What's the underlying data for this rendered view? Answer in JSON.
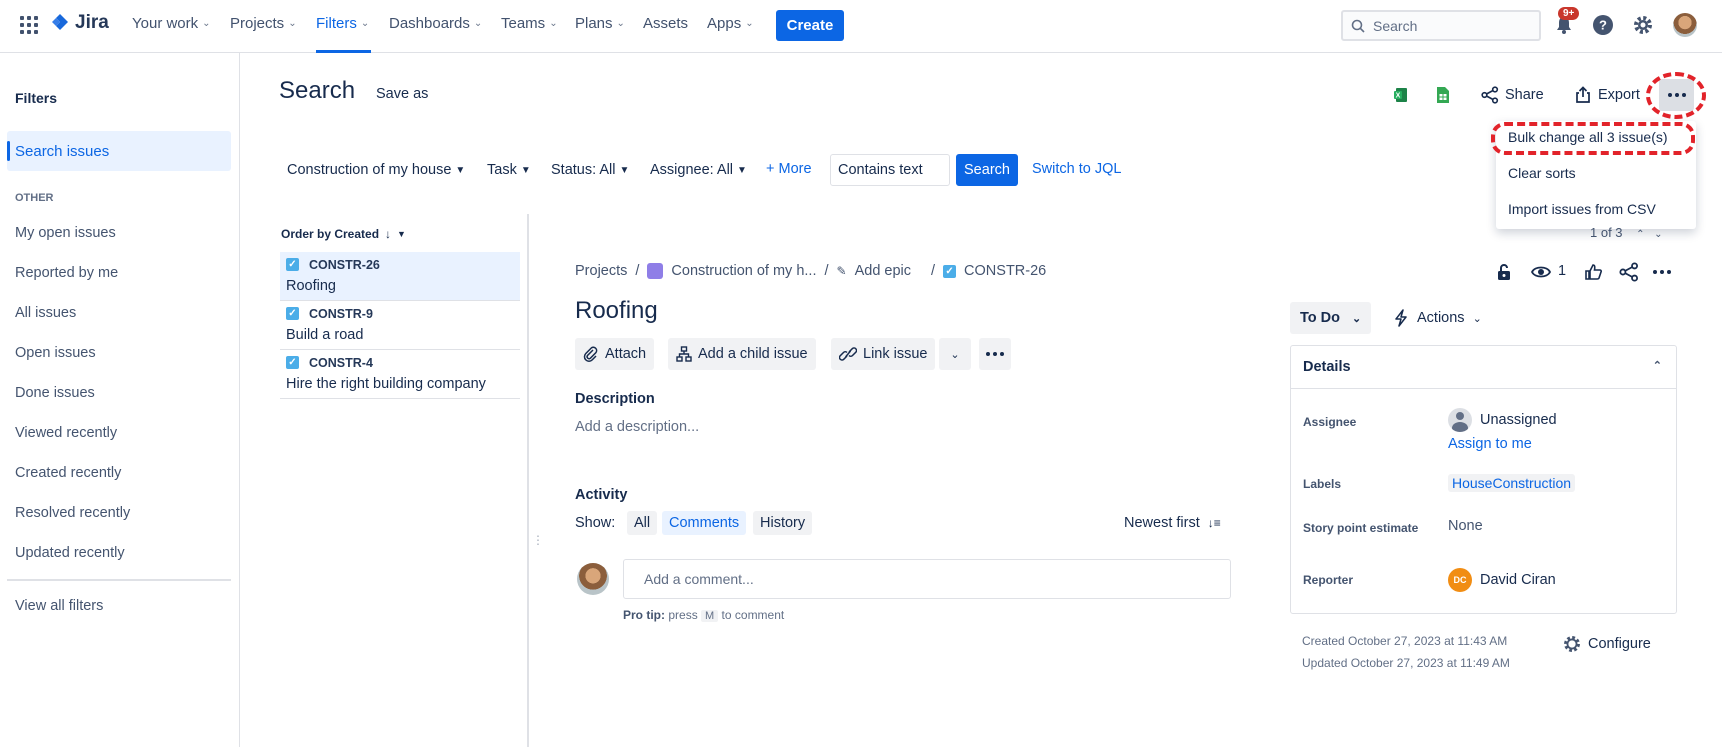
{
  "app": {
    "name": "Jira"
  },
  "topnav": {
    "items": [
      {
        "label": "Your work"
      },
      {
        "label": "Projects"
      },
      {
        "label": "Filters"
      },
      {
        "label": "Dashboards"
      },
      {
        "label": "Teams"
      },
      {
        "label": "Plans"
      },
      {
        "label": "Assets"
      },
      {
        "label": "Apps"
      }
    ],
    "create_label": "Create",
    "search_placeholder": "Search",
    "notifications_badge": "9+"
  },
  "sidebar": {
    "title": "Filters",
    "active_item": "Search issues",
    "section_label": "OTHER",
    "items": [
      {
        "label": "My open issues"
      },
      {
        "label": "Reported by me"
      },
      {
        "label": "All issues"
      },
      {
        "label": "Open issues"
      },
      {
        "label": "Done issues"
      },
      {
        "label": "Viewed recently"
      },
      {
        "label": "Created recently"
      },
      {
        "label": "Resolved recently"
      },
      {
        "label": "Updated recently"
      }
    ],
    "view_all": "View all filters"
  },
  "header": {
    "title": "Search",
    "save_as": "Save as",
    "share": "Share",
    "export": "Export"
  },
  "more_menu": {
    "items": [
      {
        "label": "Bulk change all 3 issue(s)"
      },
      {
        "label": "Clear sorts"
      },
      {
        "label": "Import issues from CSV"
      }
    ]
  },
  "filters": {
    "project": "Construction of my house",
    "type": "Task",
    "status": "Status: All",
    "assignee": "Assignee: All",
    "more": "More",
    "text_value": "Contains text",
    "search_button": "Search",
    "switch_jql": "Switch to JQL"
  },
  "issue_list": {
    "order_label": "Order by Created",
    "pager": "1 of 3",
    "issues": [
      {
        "key": "CONSTR-26",
        "title": "Roofing"
      },
      {
        "key": "CONSTR-9",
        "title": "Build a road"
      },
      {
        "key": "CONSTR-4",
        "title": "Hire the right building company"
      }
    ]
  },
  "issue": {
    "breadcrumb": {
      "projects": "Projects",
      "project_name": "Construction of my h...",
      "add_epic": "Add epic",
      "key": "CONSTR-26"
    },
    "watch_count": "1",
    "title": "Roofing",
    "actions": {
      "attach": "Attach",
      "add_child": "Add a child issue",
      "link_issue": "Link issue"
    },
    "description_heading": "Description",
    "description_placeholder": "Add a description...",
    "activity_heading": "Activity",
    "show_label": "Show:",
    "activity_filters": [
      "All",
      "Comments",
      "History"
    ],
    "sort_label": "Newest first",
    "comment_placeholder": "Add a comment...",
    "protip_prefix": "Pro tip:",
    "protip_press": "press",
    "protip_key": "M",
    "protip_suffix": "to comment",
    "status": "To Do",
    "actions_menu": "Actions",
    "details": {
      "heading": "Details",
      "assignee_label": "Assignee",
      "assignee_value": "Unassigned",
      "assign_to_me": "Assign to me",
      "labels_label": "Labels",
      "labels_value": "HouseConstruction",
      "story_points_label": "Story point estimate",
      "story_points_value": "None",
      "reporter_label": "Reporter",
      "reporter_initials": "DC",
      "reporter_value": "David Ciran"
    },
    "created": "Created October 27, 2023 at 11:43 AM",
    "updated": "Updated October 27, 2023 at 11:49 AM",
    "configure": "Configure"
  },
  "colors": {
    "accent": "#0C66E4",
    "highlight_annotation": "#E2232A"
  }
}
